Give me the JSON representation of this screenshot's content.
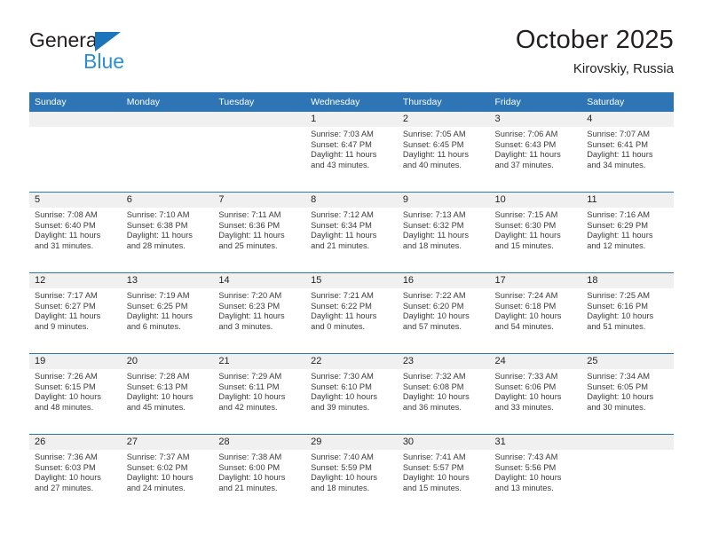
{
  "brand": {
    "name_top": "General",
    "name_bottom": "Blue",
    "triangle_color": "#1b75bb",
    "blue_text_color": "#2b8fd4"
  },
  "header": {
    "title": "October 2025",
    "subtitle": "Kirovskiy, Russia"
  },
  "theme": {
    "header_blue": "#2e75b6",
    "daynum_band": "#f0f0f0",
    "text": "#231f20"
  },
  "weekday_headers": [
    "Sunday",
    "Monday",
    "Tuesday",
    "Wednesday",
    "Thursday",
    "Friday",
    "Saturday"
  ],
  "calendar": {
    "weeks": [
      [
        {
          "day": "",
          "empty": true
        },
        {
          "day": "",
          "empty": true
        },
        {
          "day": "",
          "empty": true
        },
        {
          "day": "1",
          "sunrise": "Sunrise: 7:03 AM",
          "sunset": "Sunset: 6:47 PM",
          "daylight_1": "Daylight: 11 hours",
          "daylight_2": "and 43 minutes."
        },
        {
          "day": "2",
          "sunrise": "Sunrise: 7:05 AM",
          "sunset": "Sunset: 6:45 PM",
          "daylight_1": "Daylight: 11 hours",
          "daylight_2": "and 40 minutes."
        },
        {
          "day": "3",
          "sunrise": "Sunrise: 7:06 AM",
          "sunset": "Sunset: 6:43 PM",
          "daylight_1": "Daylight: 11 hours",
          "daylight_2": "and 37 minutes."
        },
        {
          "day": "4",
          "sunrise": "Sunrise: 7:07 AM",
          "sunset": "Sunset: 6:41 PM",
          "daylight_1": "Daylight: 11 hours",
          "daylight_2": "and 34 minutes."
        }
      ],
      [
        {
          "day": "5",
          "sunrise": "Sunrise: 7:08 AM",
          "sunset": "Sunset: 6:40 PM",
          "daylight_1": "Daylight: 11 hours",
          "daylight_2": "and 31 minutes."
        },
        {
          "day": "6",
          "sunrise": "Sunrise: 7:10 AM",
          "sunset": "Sunset: 6:38 PM",
          "daylight_1": "Daylight: 11 hours",
          "daylight_2": "and 28 minutes."
        },
        {
          "day": "7",
          "sunrise": "Sunrise: 7:11 AM",
          "sunset": "Sunset: 6:36 PM",
          "daylight_1": "Daylight: 11 hours",
          "daylight_2": "and 25 minutes."
        },
        {
          "day": "8",
          "sunrise": "Sunrise: 7:12 AM",
          "sunset": "Sunset: 6:34 PM",
          "daylight_1": "Daylight: 11 hours",
          "daylight_2": "and 21 minutes."
        },
        {
          "day": "9",
          "sunrise": "Sunrise: 7:13 AM",
          "sunset": "Sunset: 6:32 PM",
          "daylight_1": "Daylight: 11 hours",
          "daylight_2": "and 18 minutes."
        },
        {
          "day": "10",
          "sunrise": "Sunrise: 7:15 AM",
          "sunset": "Sunset: 6:30 PM",
          "daylight_1": "Daylight: 11 hours",
          "daylight_2": "and 15 minutes."
        },
        {
          "day": "11",
          "sunrise": "Sunrise: 7:16 AM",
          "sunset": "Sunset: 6:29 PM",
          "daylight_1": "Daylight: 11 hours",
          "daylight_2": "and 12 minutes."
        }
      ],
      [
        {
          "day": "12",
          "sunrise": "Sunrise: 7:17 AM",
          "sunset": "Sunset: 6:27 PM",
          "daylight_1": "Daylight: 11 hours",
          "daylight_2": "and 9 minutes."
        },
        {
          "day": "13",
          "sunrise": "Sunrise: 7:19 AM",
          "sunset": "Sunset: 6:25 PM",
          "daylight_1": "Daylight: 11 hours",
          "daylight_2": "and 6 minutes."
        },
        {
          "day": "14",
          "sunrise": "Sunrise: 7:20 AM",
          "sunset": "Sunset: 6:23 PM",
          "daylight_1": "Daylight: 11 hours",
          "daylight_2": "and 3 minutes."
        },
        {
          "day": "15",
          "sunrise": "Sunrise: 7:21 AM",
          "sunset": "Sunset: 6:22 PM",
          "daylight_1": "Daylight: 11 hours",
          "daylight_2": "and 0 minutes."
        },
        {
          "day": "16",
          "sunrise": "Sunrise: 7:22 AM",
          "sunset": "Sunset: 6:20 PM",
          "daylight_1": "Daylight: 10 hours",
          "daylight_2": "and 57 minutes."
        },
        {
          "day": "17",
          "sunrise": "Sunrise: 7:24 AM",
          "sunset": "Sunset: 6:18 PM",
          "daylight_1": "Daylight: 10 hours",
          "daylight_2": "and 54 minutes."
        },
        {
          "day": "18",
          "sunrise": "Sunrise: 7:25 AM",
          "sunset": "Sunset: 6:16 PM",
          "daylight_1": "Daylight: 10 hours",
          "daylight_2": "and 51 minutes."
        }
      ],
      [
        {
          "day": "19",
          "sunrise": "Sunrise: 7:26 AM",
          "sunset": "Sunset: 6:15 PM",
          "daylight_1": "Daylight: 10 hours",
          "daylight_2": "and 48 minutes."
        },
        {
          "day": "20",
          "sunrise": "Sunrise: 7:28 AM",
          "sunset": "Sunset: 6:13 PM",
          "daylight_1": "Daylight: 10 hours",
          "daylight_2": "and 45 minutes."
        },
        {
          "day": "21",
          "sunrise": "Sunrise: 7:29 AM",
          "sunset": "Sunset: 6:11 PM",
          "daylight_1": "Daylight: 10 hours",
          "daylight_2": "and 42 minutes."
        },
        {
          "day": "22",
          "sunrise": "Sunrise: 7:30 AM",
          "sunset": "Sunset: 6:10 PM",
          "daylight_1": "Daylight: 10 hours",
          "daylight_2": "and 39 minutes."
        },
        {
          "day": "23",
          "sunrise": "Sunrise: 7:32 AM",
          "sunset": "Sunset: 6:08 PM",
          "daylight_1": "Daylight: 10 hours",
          "daylight_2": "and 36 minutes."
        },
        {
          "day": "24",
          "sunrise": "Sunrise: 7:33 AM",
          "sunset": "Sunset: 6:06 PM",
          "daylight_1": "Daylight: 10 hours",
          "daylight_2": "and 33 minutes."
        },
        {
          "day": "25",
          "sunrise": "Sunrise: 7:34 AM",
          "sunset": "Sunset: 6:05 PM",
          "daylight_1": "Daylight: 10 hours",
          "daylight_2": "and 30 minutes."
        }
      ],
      [
        {
          "day": "26",
          "sunrise": "Sunrise: 7:36 AM",
          "sunset": "Sunset: 6:03 PM",
          "daylight_1": "Daylight: 10 hours",
          "daylight_2": "and 27 minutes."
        },
        {
          "day": "27",
          "sunrise": "Sunrise: 7:37 AM",
          "sunset": "Sunset: 6:02 PM",
          "daylight_1": "Daylight: 10 hours",
          "daylight_2": "and 24 minutes."
        },
        {
          "day": "28",
          "sunrise": "Sunrise: 7:38 AM",
          "sunset": "Sunset: 6:00 PM",
          "daylight_1": "Daylight: 10 hours",
          "daylight_2": "and 21 minutes."
        },
        {
          "day": "29",
          "sunrise": "Sunrise: 7:40 AM",
          "sunset": "Sunset: 5:59 PM",
          "daylight_1": "Daylight: 10 hours",
          "daylight_2": "and 18 minutes."
        },
        {
          "day": "30",
          "sunrise": "Sunrise: 7:41 AM",
          "sunset": "Sunset: 5:57 PM",
          "daylight_1": "Daylight: 10 hours",
          "daylight_2": "and 15 minutes."
        },
        {
          "day": "31",
          "sunrise": "Sunrise: 7:43 AM",
          "sunset": "Sunset: 5:56 PM",
          "daylight_1": "Daylight: 10 hours",
          "daylight_2": "and 13 minutes."
        },
        {
          "day": "",
          "empty": true
        }
      ]
    ]
  }
}
